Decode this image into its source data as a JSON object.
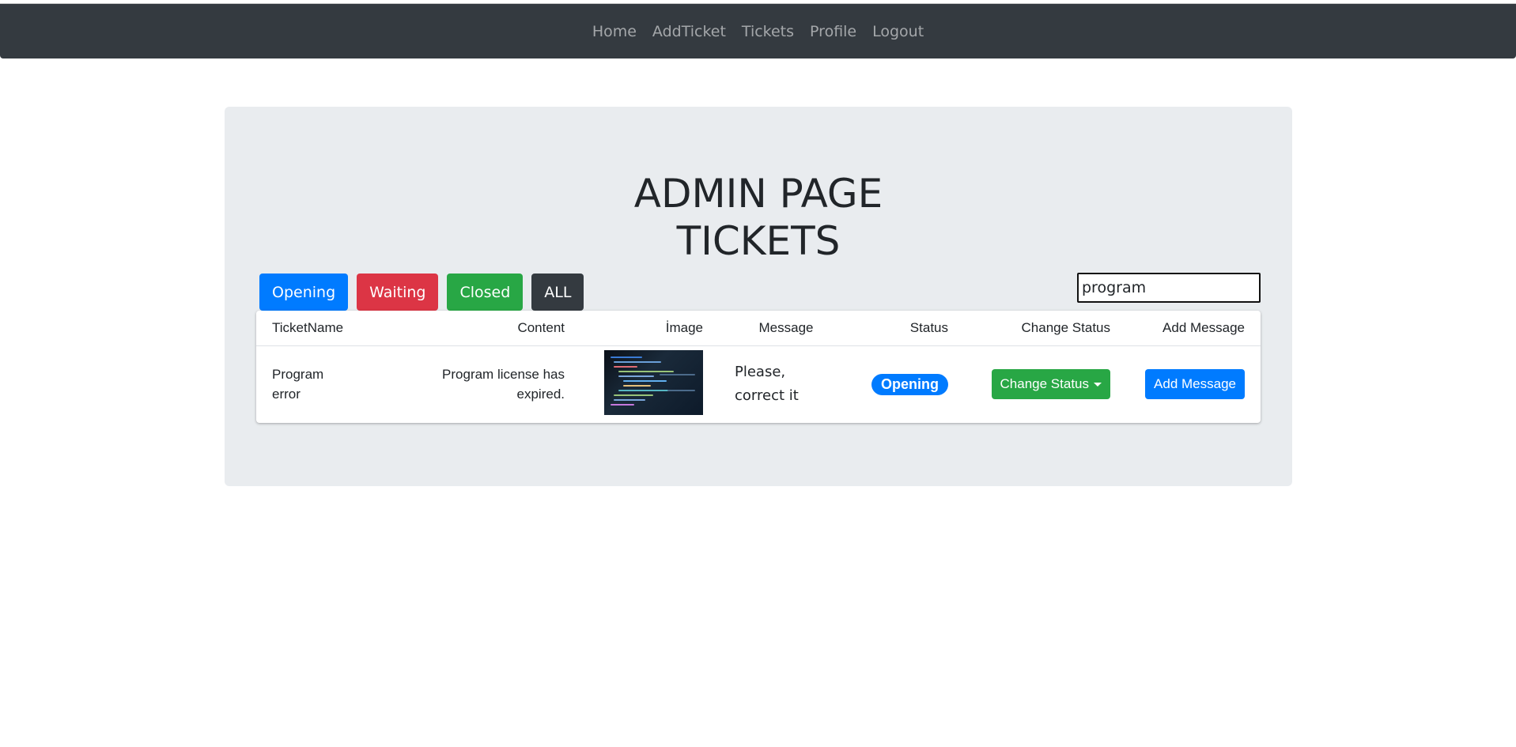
{
  "nav": {
    "items": [
      {
        "label": "Home"
      },
      {
        "label": "AddTicket"
      },
      {
        "label": "Tickets"
      },
      {
        "label": "Profile"
      },
      {
        "label": "Logout"
      }
    ]
  },
  "page": {
    "title_line1": "ADMIN PAGE",
    "title_line2": "TICKETS"
  },
  "filters": {
    "opening": "Opening",
    "waiting": "Waiting",
    "closed": "Closed",
    "all": "ALL"
  },
  "search": {
    "value": "program"
  },
  "table": {
    "headers": [
      "TicketName",
      "Content",
      "İmage",
      "Message",
      "Status",
      "Change Status",
      "Add Message"
    ],
    "rows": [
      {
        "ticket_name": "Program error",
        "content": "Program license has expired.",
        "image_icon": "code-screen-image",
        "message": "Please, correct it",
        "status": "Opening",
        "change_status_label": "Change Status",
        "add_message_label": "Add Message"
      }
    ]
  },
  "colors": {
    "navbar": "#343a40",
    "primary": "#007bff",
    "danger": "#dc3545",
    "success": "#28a745",
    "dark": "#343a40",
    "jumbotron": "#e9ecef"
  }
}
